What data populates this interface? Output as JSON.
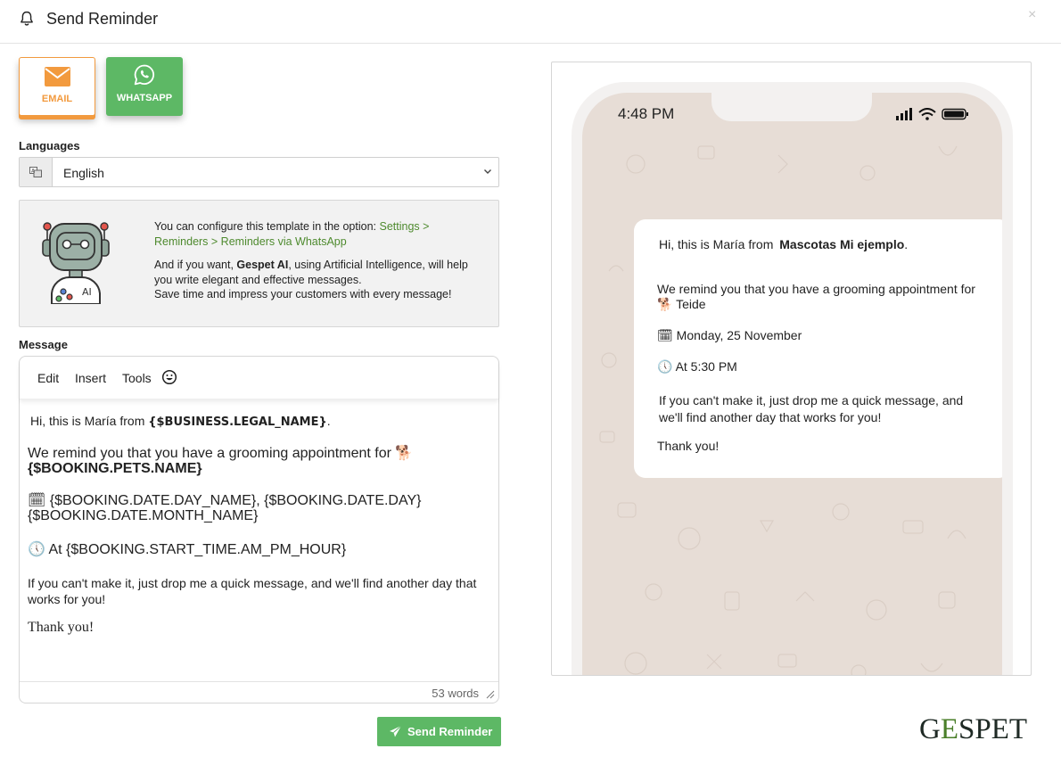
{
  "header": {
    "title": "Send Reminder",
    "close_label": "×"
  },
  "channels": {
    "email_label": "EMAIL",
    "whatsapp_label": "WHATSAPP"
  },
  "languages": {
    "label": "Languages",
    "selected": "English"
  },
  "ai_info": {
    "line1_prefix": "You can configure this template in the option: ",
    "line1_link": "Settings > Reminders > Reminders via WhatsApp",
    "line2_prefix": "And if you want, ",
    "line2_brand": "Gespet AI",
    "line2_rest": ", using Artificial Intelligence, will help you write elegant and effective messages.",
    "line3": "Save time and impress your customers with every message!"
  },
  "message": {
    "label": "Message",
    "menu": [
      "Edit",
      "Insert",
      "Tools"
    ],
    "emoji_icon": "smiley-icon",
    "lines": {
      "greeting_prefix": "Hi, this is María from ",
      "greeting_var": "{$BUSINESS.LEGAL_NAME}",
      "greeting_suffix": ".",
      "remind_text": "We remind you that you have a grooming appointment for",
      "dog_emoji": "🐕",
      "pets_var": "{$BOOKING.PETS.NAME}",
      "cal_emoji": "🗓",
      "date_text": "{$BOOKING.DATE.DAY_NAME}, {$BOOKING.DATE.DAY} {$BOOKING.DATE.MONTH_NAME}",
      "clock_emoji": "🕔",
      "time_text": "At {$BOOKING.START_TIME.AM_PM_HOUR}",
      "cant_make": "If you can't make it, just drop me a quick message, and we'll find another day that works for you!",
      "thanks": "Thank you!"
    },
    "word_count": "53 words"
  },
  "send_button": {
    "label": "Send Reminder"
  },
  "preview": {
    "time": "4:48 PM",
    "greeting_prefix": "Hi, this is María from ",
    "business": "Mascotas Mi ejemplo",
    "greeting_suffix": ".",
    "remind_line1": "We remind you that you have a grooming appointment for",
    "dog_emoji": "🐕",
    "pet_name": "Teide",
    "cal_emoji": "🗓",
    "date": "Monday, 25 November",
    "clock_emoji": "🕔",
    "time_line": "At 5:30 PM",
    "cant_make_1": "If you can't make it, just drop me a quick message, and",
    "cant_make_2": "we'll find  another day that works for you!",
    "thanks": "Thank you!"
  },
  "brand": {
    "logo_text_1": "G",
    "logo_text_e": "E",
    "logo_text_2": "SPET"
  },
  "colors": {
    "accent_green": "#5db865",
    "email_orange": "#f29a3e",
    "link_green": "#4e8a2e",
    "wa_background": "#e7ddd6"
  }
}
